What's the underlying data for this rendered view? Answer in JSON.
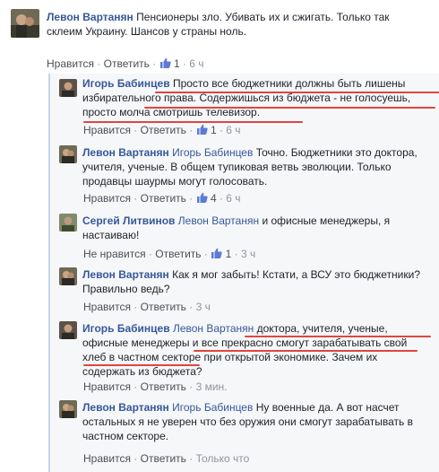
{
  "top": {
    "author": "Левон Вартанян",
    "text": "Пенсионеры зло. Убивать их и сжигать. Только так склеим Украину. Шансов у страны ноль.",
    "like": "Нравится",
    "reply": "Ответить",
    "likes": "1",
    "time": "6 ч"
  },
  "replies": [
    {
      "author": "Игорь Бабинцев",
      "tag": "",
      "text": "Просто все бюджетники должны быть лишены избирательного права. Содержишься из бюджета - не голосуешь, просто молча смотришь телевизор.",
      "like": "Нравится",
      "reply": "Ответить",
      "likes": "1",
      "time": "6 ч"
    },
    {
      "author": "Левон Вартанян",
      "tag": "Игорь Бабинцев",
      "text": "Точно. Бюджетники это доктора, учителя, ученые. В общем тупиковая ветвь эволюции. Только продавцы шаурмы могут голосовать.",
      "like": "Нравится",
      "reply": "Ответить",
      "likes": "4",
      "time": "6 ч"
    },
    {
      "author": "Сергей Литвинов",
      "tag": "Левон Вартанян",
      "text": "и офисные менеджеры, я настаиваю!",
      "like": "Не нравится",
      "reply": "Ответить",
      "likes": "1",
      "time": "3 ч"
    },
    {
      "author": "Левон Вартанян",
      "tag": "",
      "text": "Как я мог забыть! Кстати, а ВСУ это бюджетники? Правильно ведь?",
      "like": "Нравится",
      "reply": "Ответить",
      "likes": "",
      "time": "3 ч"
    },
    {
      "author": "Игорь Бабинцев",
      "tag": "Левон Вартанян",
      "text": "доктора, учителя, ученые, офисные менеджеры и все прекрасно смогут зарабатывать свой хлеб в частном секторе при открытой экономике. Зачем их содержать из бюджета?",
      "like": "Нравится",
      "reply": "Ответить",
      "likes": "",
      "time": "3 мин."
    },
    {
      "author": "Левон Вартанян",
      "tag": "Игорь Бабинцев",
      "text": "Ну военные да. А вот насчет остальных я не уверен что без оружия они смогут зарабатывать в частном секторе.",
      "like": "Нравится",
      "reply": "Ответить",
      "likes": "",
      "time": "Только что"
    }
  ],
  "colors": {
    "link": "#365899",
    "meta": "#90949c",
    "underline": "#e0463e",
    "thread": "#c9d4e7"
  }
}
